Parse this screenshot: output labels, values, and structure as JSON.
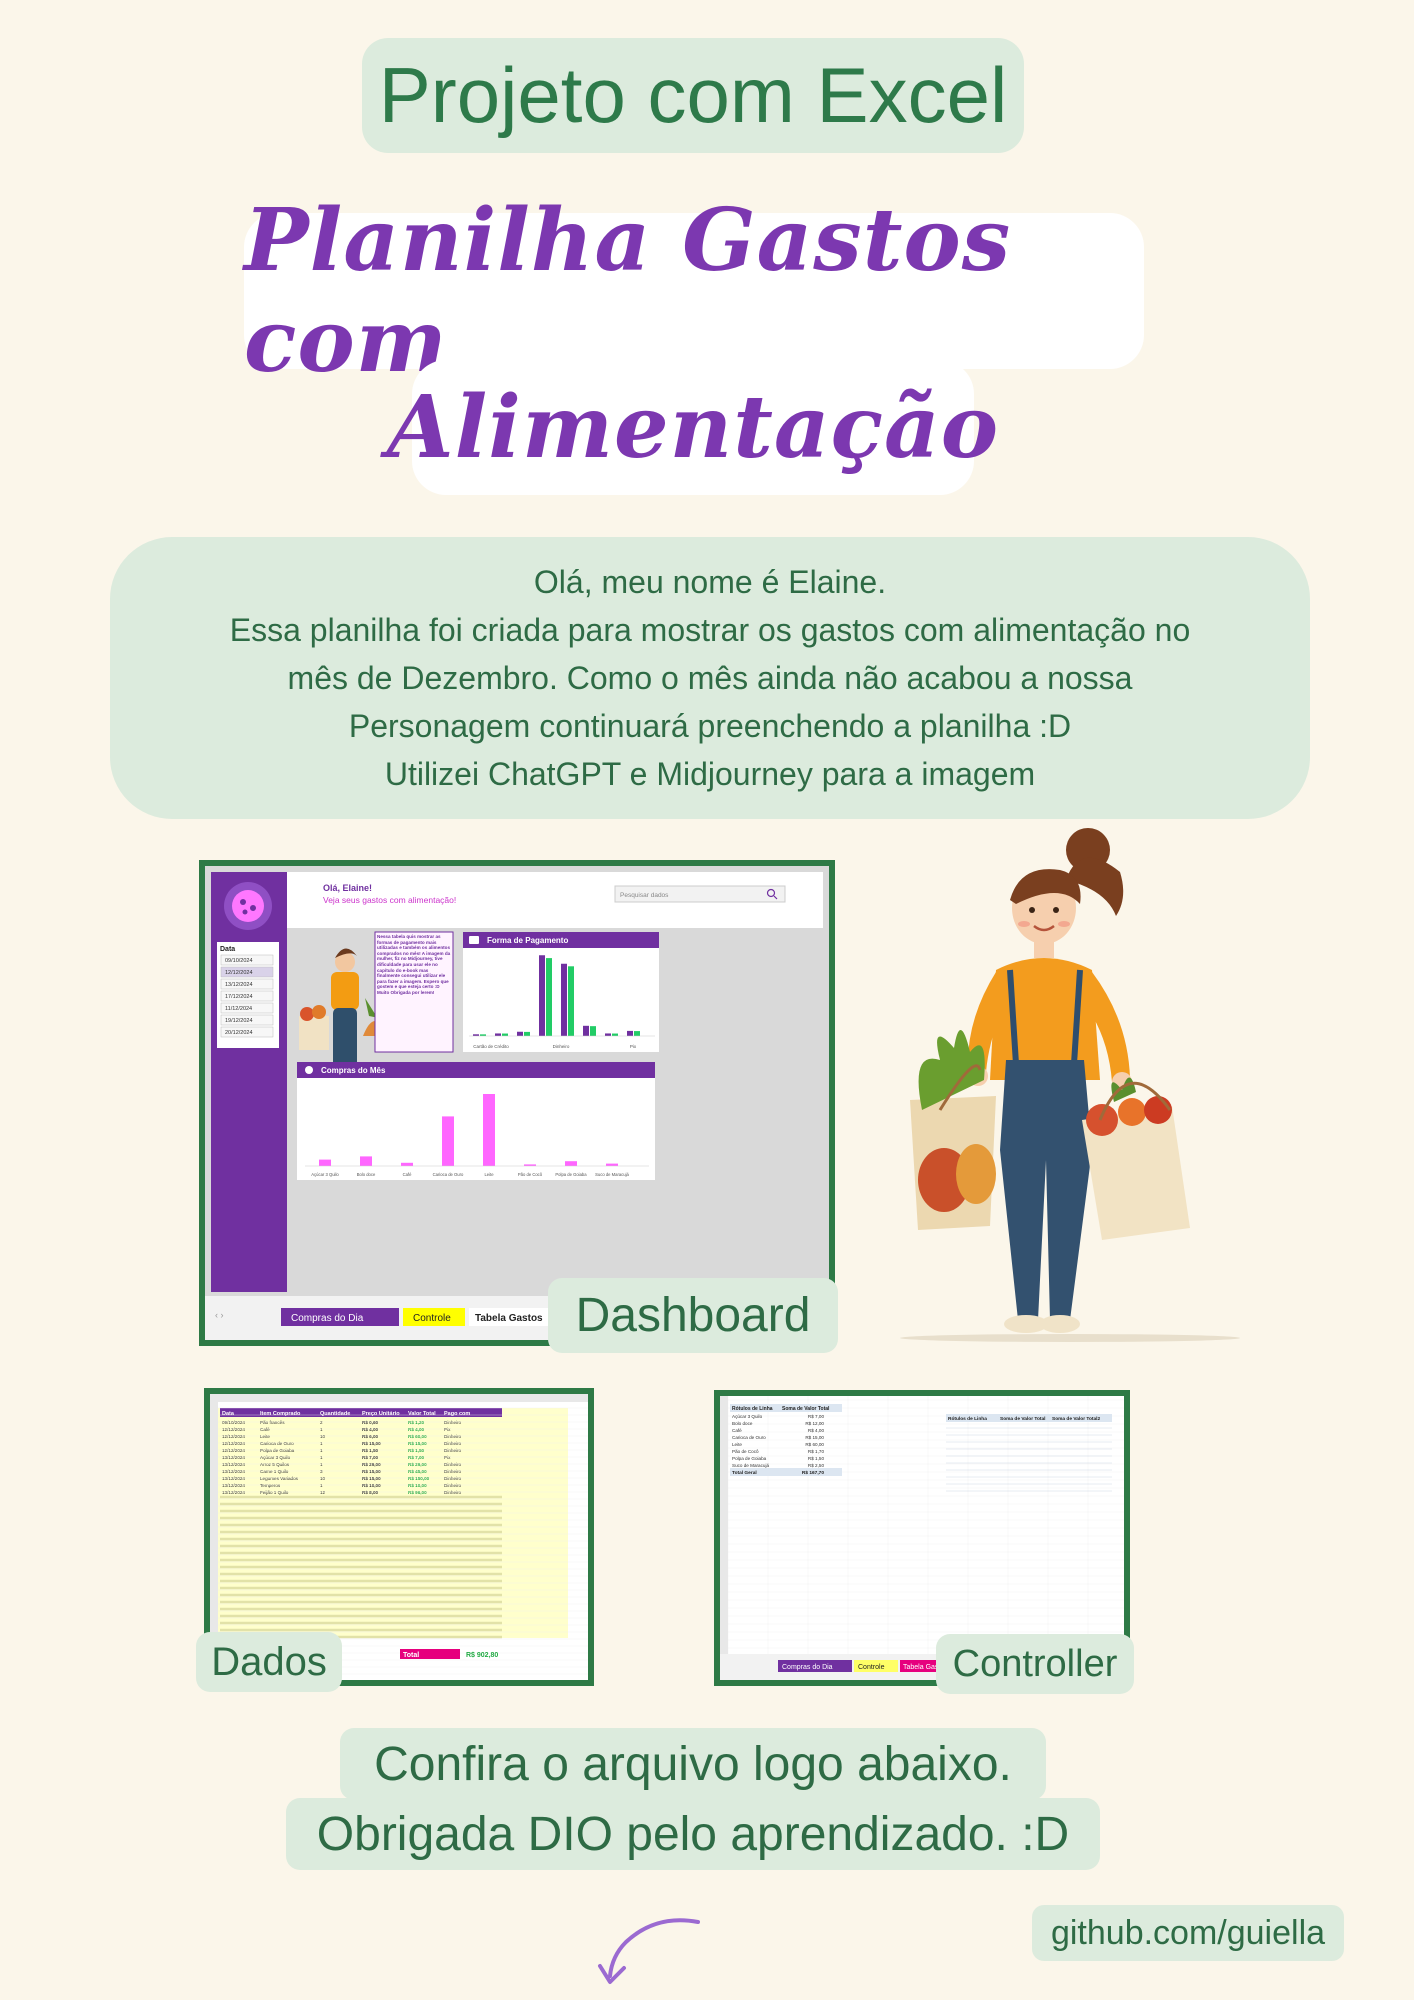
{
  "header": {
    "project_title": "Projeto com Excel"
  },
  "main_title": {
    "line1": "Planilha Gastos com",
    "line2": "Alimentação"
  },
  "intro": {
    "lines": [
      "Olá, meu nome é Elaine.",
      "Essa planilha foi criada para mostrar os gastos com alimentação no",
      "mês de Dezembro. Como o mês ainda não acabou a nossa",
      "Personagem continuará preenchendo a planilha :D",
      "Utilizei ChatGPT e Midjourney para a imagem"
    ]
  },
  "dashboard": {
    "label": "Dashboard",
    "greeting": "Olá, Elaine!",
    "subgreeting": "Veja seus gastos com alimentação!",
    "search_placeholder": "Pesquisar dados",
    "slicer_title": "Data",
    "dates": [
      "09/10/2024",
      "12/12/2024",
      "13/12/2024",
      "17/12/2024",
      "11/12/2024",
      "19/12/2024",
      "20/12/2024"
    ],
    "note": "Nessa tabela quis mostrar as formas de pagamento mais utilizadas e também os alimentos comprados no mês! A imagem da mulher, fiz no Midjourney, tive dificuldade para usar ele no capítulo do e-book mas finalmente consegui utilizar ele para fazer a imagem. Espero que gostem e que esteja certo :D Muito Obrigada por lerem!",
    "chart1_title": "Forma de Pagamento",
    "chart1_groups": [
      "Cartão de Crédito",
      "Dinheiro",
      "Pix"
    ],
    "chart2_title": "Compras do Mês",
    "chart2_categories": [
      "Açúcar 3 Quilo",
      "Bolo doce",
      "Café",
      "Carioca de Ouro",
      "Leite",
      "Pão de Cocô",
      "Polpa de Goiaba",
      "Suco de Maracujá"
    ],
    "chart2_values": [
      8,
      12,
      4,
      62,
      90,
      2,
      6,
      3
    ],
    "tabs": [
      "Compras do Dia",
      "Controle",
      "Tabela Gastos"
    ]
  },
  "dados": {
    "label": "Dados",
    "headers": [
      "Data",
      "Item Comprado",
      "Quantidade",
      "Preço Unitário",
      "Valor Total",
      "Pago com"
    ],
    "rows": [
      [
        "09/10/2024",
        "Pão francês",
        "2",
        "R$ 0,60",
        "R$ 1,20",
        "Dinheiro"
      ],
      [
        "12/12/2024",
        "Café",
        "1",
        "R$ 4,00",
        "R$ 4,00",
        "Pix"
      ],
      [
        "12/12/2024",
        "Leite",
        "10",
        "R$ 6,00",
        "R$ 60,00",
        "Dinheiro"
      ],
      [
        "12/12/2024",
        "Carioca de Ouro",
        "1",
        "R$ 15,00",
        "R$ 15,00",
        "Dinheiro"
      ],
      [
        "12/12/2024",
        "Polpa de Goiaba",
        "1",
        "R$ 1,50",
        "R$ 1,50",
        "Dinheiro"
      ],
      [
        "13/12/2024",
        "Açúcar 3 Quilo",
        "1",
        "R$ 7,00",
        "R$ 7,00",
        "Pix"
      ],
      [
        "13/12/2024",
        "Arroz 5 Quilos",
        "1",
        "R$ 29,00",
        "R$ 29,00",
        "Dinheiro"
      ],
      [
        "13/12/2024",
        "Carne 1 Quilo",
        "3",
        "R$ 15,00",
        "R$ 45,00",
        "Dinheiro"
      ],
      [
        "13/12/2024",
        "Legumes Variados",
        "10",
        "R$ 15,00",
        "R$ 150,00",
        "Dinheiro"
      ],
      [
        "13/12/2024",
        "Temperos",
        "1",
        "R$ 10,00",
        "R$ 10,00",
        "Dinheiro"
      ],
      [
        "13/12/2024",
        "Feijão 1 Quilo",
        "12",
        "R$ 8,00",
        "R$ 96,00",
        "Dinheiro"
      ]
    ],
    "total_label": "Total",
    "total_value": "R$ 902,80"
  },
  "controller": {
    "label": "Controller",
    "pivot1_headers": [
      "Rótulos de Linha",
      "Soma de Valor Total"
    ],
    "pivot1_rows": [
      [
        "Açúcar 3 Quilo",
        "R$ 7,00"
      ],
      [
        "Bolo doce",
        "R$ 12,00"
      ],
      [
        "Café",
        "R$ 4,00"
      ],
      [
        "Carioca de Ouro",
        "R$ 15,00"
      ],
      [
        "Leite",
        "R$ 60,00"
      ],
      [
        "Pão de Cocô",
        "R$ 1,70"
      ],
      [
        "Polpa de Goiaba",
        "R$ 1,50"
      ],
      [
        "Suco de Maracujá",
        "R$ 2,50"
      ]
    ],
    "pivot1_total": [
      "Total Geral",
      "R$ 167,70"
    ],
    "pivot2_headers": [
      "Rótulos de Linha",
      "Soma de Valor Total",
      "Soma de Valor Total2"
    ],
    "tabs": [
      "Compras do Dia",
      "Controle",
      "Tabela Gastos"
    ]
  },
  "footer": {
    "line1": "Confira o arquivo logo abaixo.",
    "line2": "Obrigada DIO pelo aprendizado. :D",
    "github": "github.com/guiella"
  },
  "colors": {
    "purple": "#7030a0",
    "green": "#2e7a46",
    "mint": "#dcebdd",
    "cream": "#fbf6ea",
    "pink": "#ff66ff",
    "bright_green": "#22cc66"
  }
}
